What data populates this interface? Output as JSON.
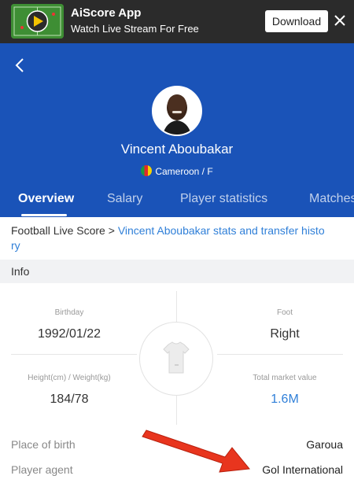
{
  "banner": {
    "title": "AiScore App",
    "subtitle": "Watch Live Stream For Free",
    "download_label": "Download",
    "close_icon": "close-icon"
  },
  "player": {
    "name": "Vincent Aboubakar",
    "meta": "Cameroon / F"
  },
  "tabs": [
    {
      "label": "Overview",
      "active": true
    },
    {
      "label": "Salary",
      "active": false
    },
    {
      "label": "Player statistics",
      "active": false
    },
    {
      "label": "Matches",
      "active": false
    }
  ],
  "breadcrumb": {
    "home": "Football Live Score",
    "separator": ">",
    "current_line1": "Vincent Aboubakar stats and transfer histo",
    "current_line2": "ry"
  },
  "section": {
    "info_label": "Info"
  },
  "stats": {
    "birthday_label": "Birthday",
    "birthday_value": "1992/01/22",
    "foot_label": "Foot",
    "foot_value": "Right",
    "height_weight_label": "Height(cm) / Weight(kg)",
    "height_weight_value": "184/78",
    "market_value_label": "Total market value",
    "market_value_value": "1.6M"
  },
  "rows": [
    {
      "label": "Place of birth",
      "value": "Garoua"
    },
    {
      "label": "Player agent",
      "value": "Gol International"
    }
  ],
  "colors": {
    "brand_blue": "#1a53b8",
    "link_blue": "#2f7fd8",
    "annotation_red": "#e8351e"
  }
}
